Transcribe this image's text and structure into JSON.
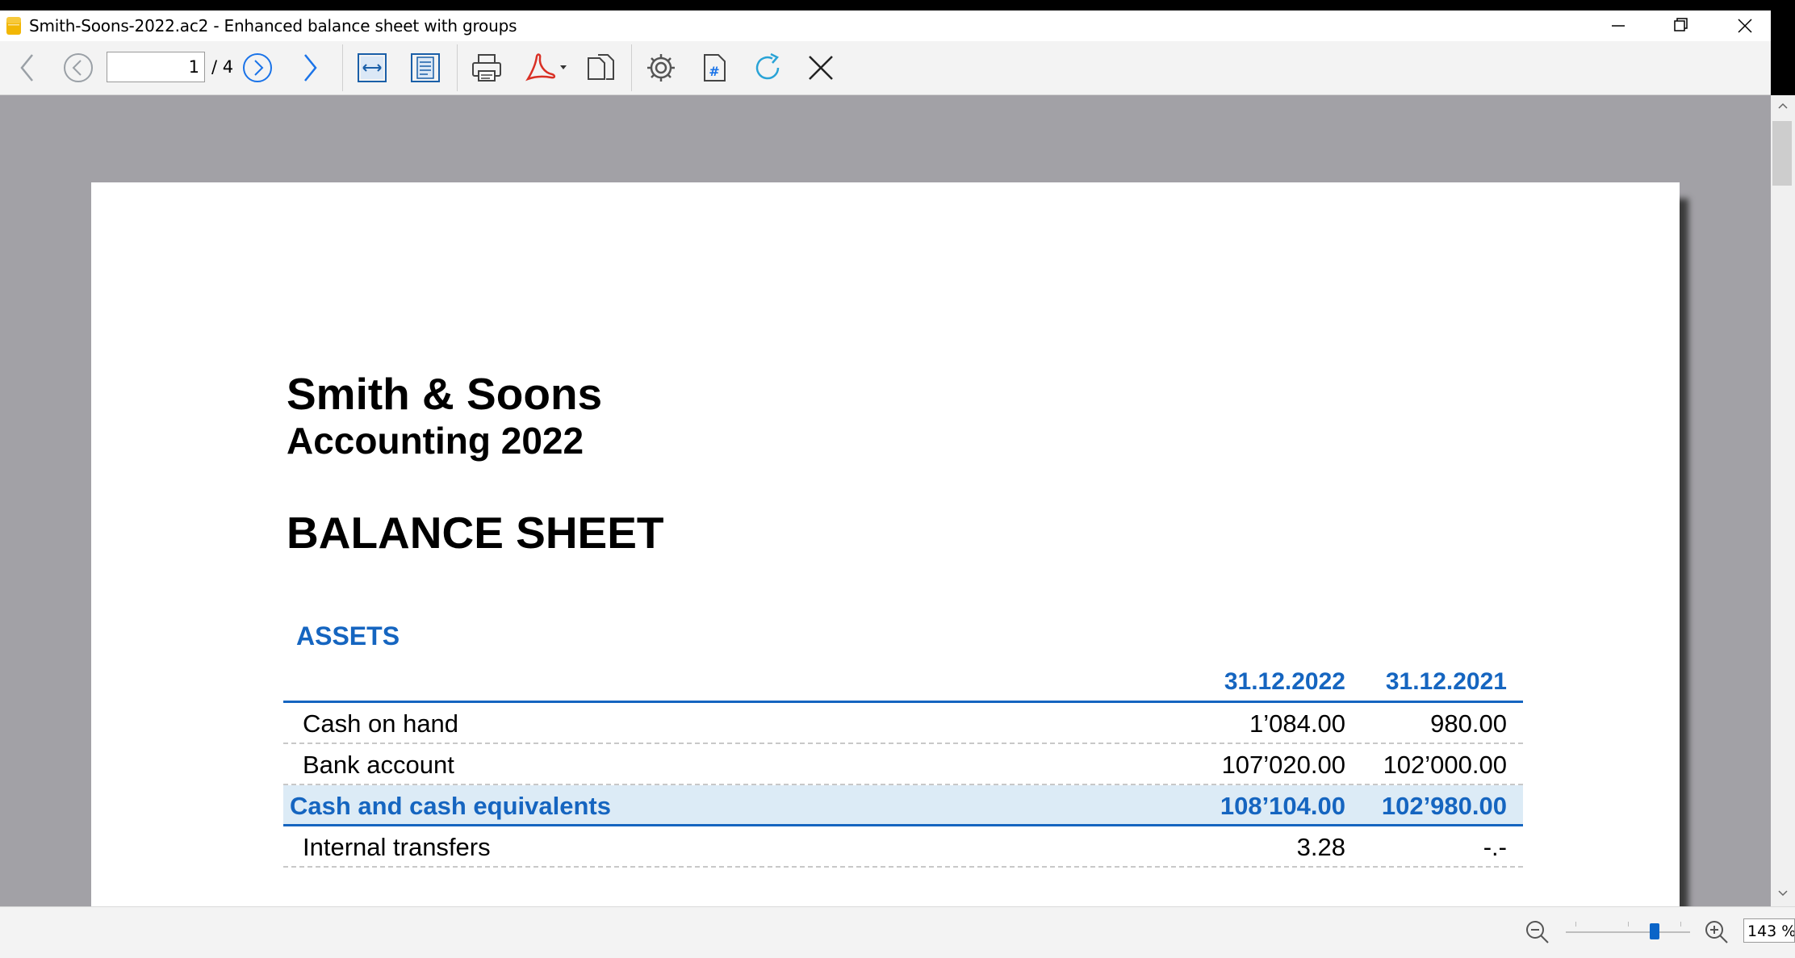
{
  "window": {
    "title": "Smith-Soons-2022.ac2 - Enhanced balance sheet with groups"
  },
  "toolbar": {
    "current_page": "1",
    "page_total": "/ 4"
  },
  "report": {
    "company": "Smith & Soons",
    "subtitle": "Accounting 2022",
    "title": "BALANCE SHEET",
    "section": "ASSETS",
    "columns": [
      "31.12.2022",
      "31.12.2021"
    ],
    "rows": [
      {
        "label": "Cash on hand",
        "v1": "1’084.00",
        "v2": "980.00",
        "total": false
      },
      {
        "label": "Bank account",
        "v1": "107’020.00",
        "v2": "102’000.00",
        "total": false
      },
      {
        "label": "Cash and cash equivalents",
        "v1": "108’104.00",
        "v2": "102’980.00",
        "total": true
      },
      {
        "label": "Internal transfers",
        "v1": "3.28",
        "v2": "-.-",
        "total": false
      }
    ]
  },
  "status": {
    "zoom": "143 %",
    "zoom_level": 0.73
  },
  "colors": {
    "accent": "#1565c0",
    "total_row_bg": "#dcebf6",
    "viewport_bg": "#a2a1a6"
  },
  "icons": {
    "toolbar": [
      "arrow-left-icon",
      "circle-prev-icon",
      "circle-next-icon",
      "arrow-right-icon",
      "fit-width-icon",
      "fit-page-icon",
      "printer-icon",
      "pdf-icon",
      "copy-pages-icon",
      "gear-icon",
      "page-number-icon",
      "refresh-icon",
      "close-icon"
    ]
  }
}
